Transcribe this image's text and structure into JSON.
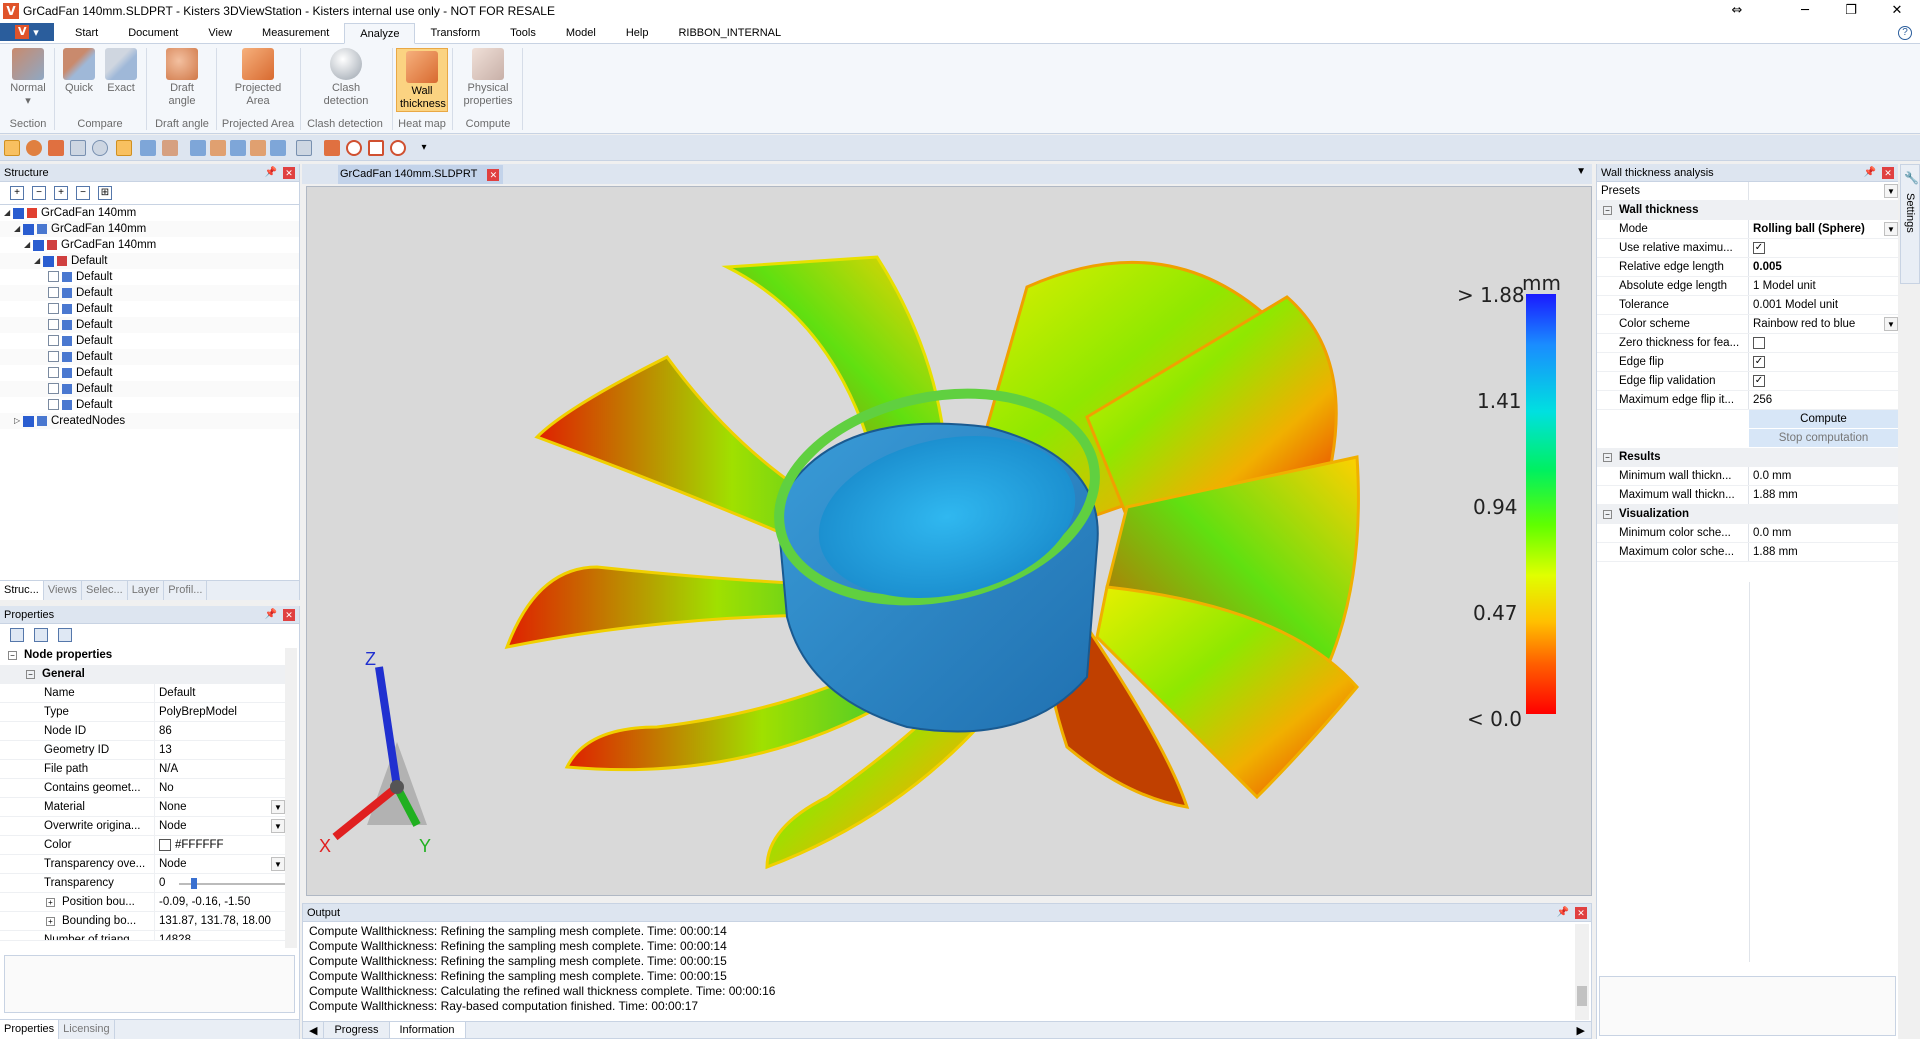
{
  "window": {
    "title": "GrCadFan 140mm.SLDPRT - Kisters 3DViewStation - Kisters internal use only - NOT FOR RESALE"
  },
  "menu": {
    "tabs": [
      "Start",
      "Document",
      "View",
      "Measurement",
      "Analyze",
      "Transform",
      "Tools",
      "Model",
      "Help",
      "RIBBON_INTERNAL"
    ],
    "active": "Analyze"
  },
  "ribbon": {
    "buttons": {
      "normal": "Normal",
      "quick": "Quick",
      "exact": "Exact",
      "draft_angle": "Draft angle",
      "projected_area": "Projected Area",
      "clash_detection": "Clash detection",
      "wall_thickness": "Wall thickness",
      "physical_properties": "Physical properties"
    },
    "groups": {
      "section": "Section",
      "compare": "Compare",
      "draft_angle": "Draft angle",
      "projected_area": "Projected Area",
      "clash_detection": "Clash detection",
      "heat_map": "Heat map",
      "compute": "Compute"
    }
  },
  "structure": {
    "title": "Structure",
    "nodes": [
      {
        "label": "GrCadFan 140mm",
        "indent": 0
      },
      {
        "label": "GrCadFan 140mm",
        "indent": 1
      },
      {
        "label": "GrCadFan 140mm",
        "indent": 2
      },
      {
        "label": "Default",
        "indent": 3
      },
      {
        "label": "Default",
        "indent": 4
      },
      {
        "label": "Default",
        "indent": 4
      },
      {
        "label": "Default",
        "indent": 4
      },
      {
        "label": "Default",
        "indent": 4
      },
      {
        "label": "Default",
        "indent": 4
      },
      {
        "label": "Default",
        "indent": 4
      },
      {
        "label": "Default",
        "indent": 4
      },
      {
        "label": "Default",
        "indent": 4
      },
      {
        "label": "Default",
        "indent": 4
      },
      {
        "label": "CreatedNodes",
        "indent": 1
      }
    ],
    "tabs": [
      "Struc...",
      "Views",
      "Selec...",
      "Layer",
      "Profil..."
    ]
  },
  "properties": {
    "title": "Properties",
    "section": "Node properties",
    "subsection": "General",
    "rows": [
      {
        "k": "Name",
        "v": "Default"
      },
      {
        "k": "Type",
        "v": "PolyBrepModel"
      },
      {
        "k": "Node ID",
        "v": "86"
      },
      {
        "k": "Geometry ID",
        "v": "13"
      },
      {
        "k": "File path",
        "v": "N/A"
      },
      {
        "k": "Contains geomet...",
        "v": "No"
      },
      {
        "k": "Material",
        "v": "None"
      },
      {
        "k": "Overwrite origina...",
        "v": "Node"
      },
      {
        "k": "Color",
        "v": "#FFFFFF"
      },
      {
        "k": "Transparency ove...",
        "v": "Node"
      },
      {
        "k": "Transparency",
        "v": "0"
      },
      {
        "k": "Position bou...",
        "v": "-0.09, -0.16, -1.50"
      },
      {
        "k": "Bounding bo...",
        "v": "131.87, 131.78, 18.00"
      },
      {
        "k": "Number of triang...",
        "v": "14828"
      }
    ],
    "tabs": [
      "Properties",
      "Licensing"
    ]
  },
  "viewport": {
    "doc_tab": "GrCadFan 140mm.SLDPRT",
    "legend": {
      "unit": "mm",
      "labels": [
        "> 1.88",
        "1.41",
        "0.94",
        "0.47",
        "< 0.0"
      ]
    },
    "axes": {
      "x": "X",
      "y": "Y",
      "z": "Z"
    }
  },
  "wall_thickness": {
    "title": "Wall thickness analysis",
    "presets_label": "Presets",
    "section_wall": "Wall thickness",
    "rows": [
      {
        "k": "Mode",
        "v": "Rolling ball (Sphere)"
      },
      {
        "k": "Use relative maximu...",
        "v": "✓"
      },
      {
        "k": "Relative edge length",
        "v": "0.005"
      },
      {
        "k": "Absolute edge length",
        "v": "1 Model unit"
      },
      {
        "k": "Tolerance",
        "v": "0.001 Model unit"
      },
      {
        "k": "Color scheme",
        "v": "Rainbow red to blue"
      },
      {
        "k": "Zero thickness for fea...",
        "v": ""
      },
      {
        "k": "Edge flip",
        "v": "✓"
      },
      {
        "k": "Edge flip validation",
        "v": "✓"
      },
      {
        "k": "Maximum edge flip it...",
        "v": "256"
      }
    ],
    "compute_btn": "Compute",
    "stop_btn": "Stop computation",
    "section_results": "Results",
    "results": [
      {
        "k": "Minimum wall thickn...",
        "v": "0.0 mm"
      },
      {
        "k": "Maximum wall thickn...",
        "v": "1.88 mm"
      }
    ],
    "section_vis": "Visualization",
    "visualization": [
      {
        "k": "Minimum color sche...",
        "v": "0.0 mm"
      },
      {
        "k": "Maximum color sche...",
        "v": "1.88 mm"
      }
    ],
    "settings_tab": "Settings"
  },
  "output": {
    "title": "Output",
    "lines": [
      "Compute Wallthickness: Refining the sampling mesh complete. Time: 00:00:14",
      "Compute Wallthickness: Refining the sampling mesh complete. Time: 00:00:14",
      "Compute Wallthickness: Refining the sampling mesh complete. Time: 00:00:15",
      "Compute Wallthickness: Refining the sampling mesh complete. Time: 00:00:15",
      "Compute Wallthickness: Calculating the refined wall thickness complete. Time: 00:00:16",
      "Compute Wallthickness: Ray-based computation finished. Time: 00:00:17"
    ],
    "tabs": [
      "Progress",
      "Information"
    ]
  }
}
